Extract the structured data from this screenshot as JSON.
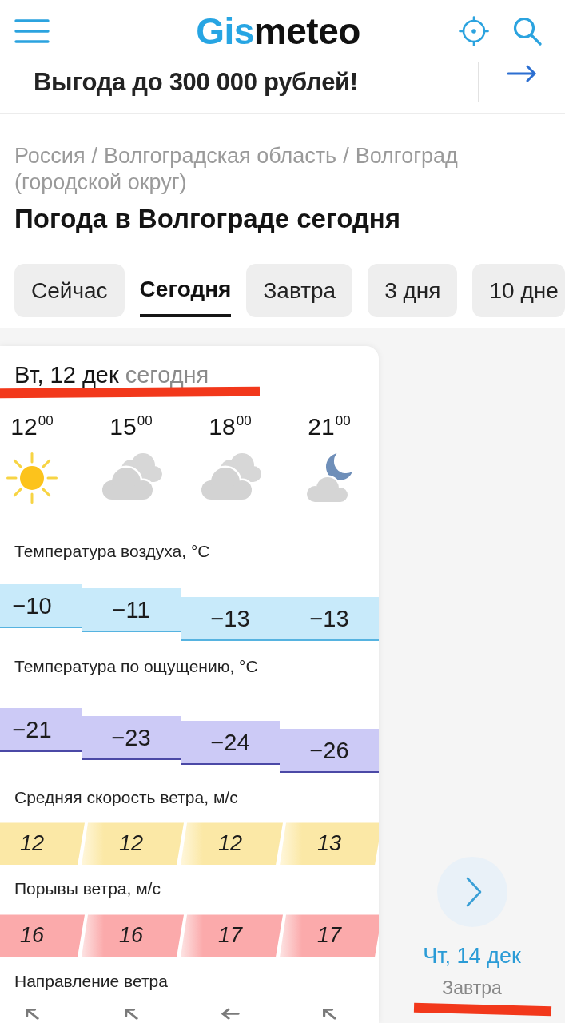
{
  "header": {
    "logo": {
      "accent": "Gis",
      "rest": "meteo"
    }
  },
  "promo": {
    "text": "Выгода до 300 000 рублей!"
  },
  "breadcrumbs": {
    "items": [
      "Россия",
      "Волгоградская область",
      "Волгоград"
    ],
    "separator": "/",
    "note": "(городской округ)"
  },
  "title": "Погода в Волгограде сегодня",
  "tabs": [
    {
      "label": "Сейчас",
      "selected": false
    },
    {
      "label": "Сегодня",
      "selected": true
    },
    {
      "label": "Завтра",
      "selected": false
    },
    {
      "label": "3 дня",
      "selected": false
    },
    {
      "label": "10 дне",
      "selected": false
    }
  ],
  "forecast": {
    "date": {
      "label": "Вт, 12 дек",
      "note": "сегодня",
      "marked": true
    },
    "hours": [
      {
        "time": "12$^{00}$",
        "kind": "sun"
      },
      {
        "time": "15$^{00}$",
        "kind": "clouds"
      },
      {
        "time": "18$^{00}$",
        "kind": "clouds"
      },
      {
        "time": "21$^{00}$",
        "kind": "moon-cloud"
      }
    ],
    "rows": [
      {
        "kind": "temperature",
        "label": "Температура воздуха, °C",
        "values": [
          "−10",
          "−11",
          "−13",
          "−13"
        ]
      },
      {
        "kind": "feels",
        "label": "Температура по ощущению, °C",
        "values": [
          "−21",
          "−23",
          "−24",
          "−26"
        ]
      },
      {
        "kind": "wind",
        "label": "Средняя скорость ветра, м/с",
        "values": [
          "12",
          "12",
          "12",
          "13"
        ]
      },
      {
        "kind": "gusts",
        "label": "Порывы ветра, м/с",
        "values": [
          "16",
          "16",
          "17",
          "17"
        ]
      },
      {
        "kind": "direction",
        "label": "Направление ветра",
        "arrows": [
          {
            "kind": "up-left"
          },
          {
            "kind": "up-left"
          },
          {
            "kind": "left"
          },
          {
            "kind": "up-left"
          }
        ]
      }
    ]
  },
  "next_day": {
    "date": "Чт, 14 дек",
    "note": "Завтра",
    "marked": true
  }
}
